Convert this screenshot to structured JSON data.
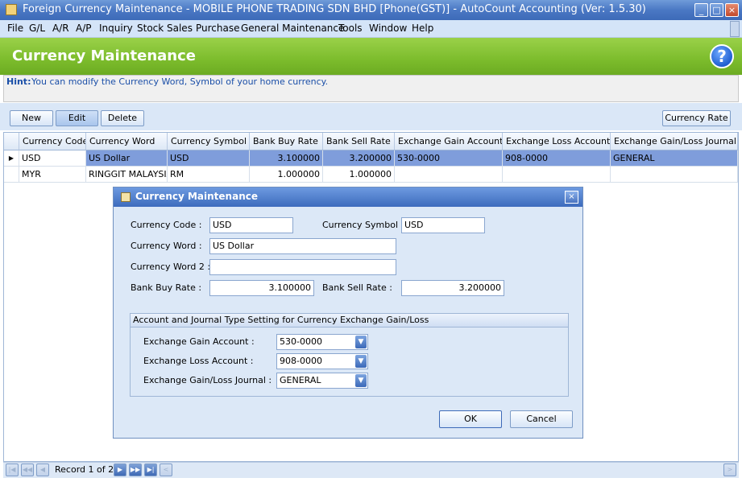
{
  "window": {
    "title": "Foreign Currency Maintenance - MOBILE PHONE TRADING SDN BHD [Phone(GST)] - AutoCount Accounting (Ver: 1.5.30)",
    "min": "_",
    "max": "□",
    "close": "×"
  },
  "menu": [
    "File",
    "G/L",
    "A/R",
    "A/P",
    "Inquiry",
    "Stock",
    "Sales",
    "Purchase",
    "General Maintenance",
    "Tools",
    "Window",
    "Help"
  ],
  "header": {
    "title": "Currency Maintenance",
    "help": "?"
  },
  "hint": {
    "label": "Hint:",
    "text": "You can modify the Currency Word, Symbol of your home currency."
  },
  "toolbar": {
    "new": "New",
    "edit": "Edit",
    "delete": "Delete",
    "currency_rate": "Currency Rate"
  },
  "grid": {
    "columns": [
      "Currency Code",
      "Currency Word",
      "Currency Symbol",
      "Bank Buy Rate",
      "Bank Sell Rate",
      "Exchange Gain Account",
      "Exchange Loss Account",
      "Exchange Gain/Loss Journal"
    ],
    "rows": [
      [
        "USD",
        "US Dollar",
        "USD",
        "3.100000",
        "3.200000",
        "530-0000",
        "908-0000",
        "GENERAL"
      ],
      [
        "MYR",
        "RINGGIT MALAYSIA",
        "RM",
        "1.000000",
        "1.000000",
        "",
        "",
        ""
      ]
    ]
  },
  "navigator": {
    "record_text": "Record 1 of 2"
  },
  "dialog": {
    "title": "Currency Maintenance",
    "close": "×",
    "currency_code_label": "Currency Code :",
    "currency_code": "USD",
    "currency_symbol_label": "Currency Symbol :",
    "currency_symbol": "USD",
    "currency_word_label": "Currency Word :",
    "currency_word": "US Dollar",
    "currency_word2_label": "Currency Word 2 :",
    "currency_word2": "",
    "bank_buy_label": "Bank Buy Rate :",
    "bank_buy": "3.100000",
    "bank_sell_label": "Bank Sell Rate :",
    "bank_sell": "3.200000",
    "group_title": "Account and Journal Type Setting for Currency Exchange Gain/Loss",
    "gain_label": "Exchange Gain Account :",
    "gain_value": "530-0000",
    "loss_label": "Exchange Loss Account :",
    "loss_value": "908-0000",
    "journal_label": "Exchange Gain/Loss Journal :",
    "journal_value": "GENERAL",
    "ok": "OK",
    "cancel": "Cancel"
  }
}
